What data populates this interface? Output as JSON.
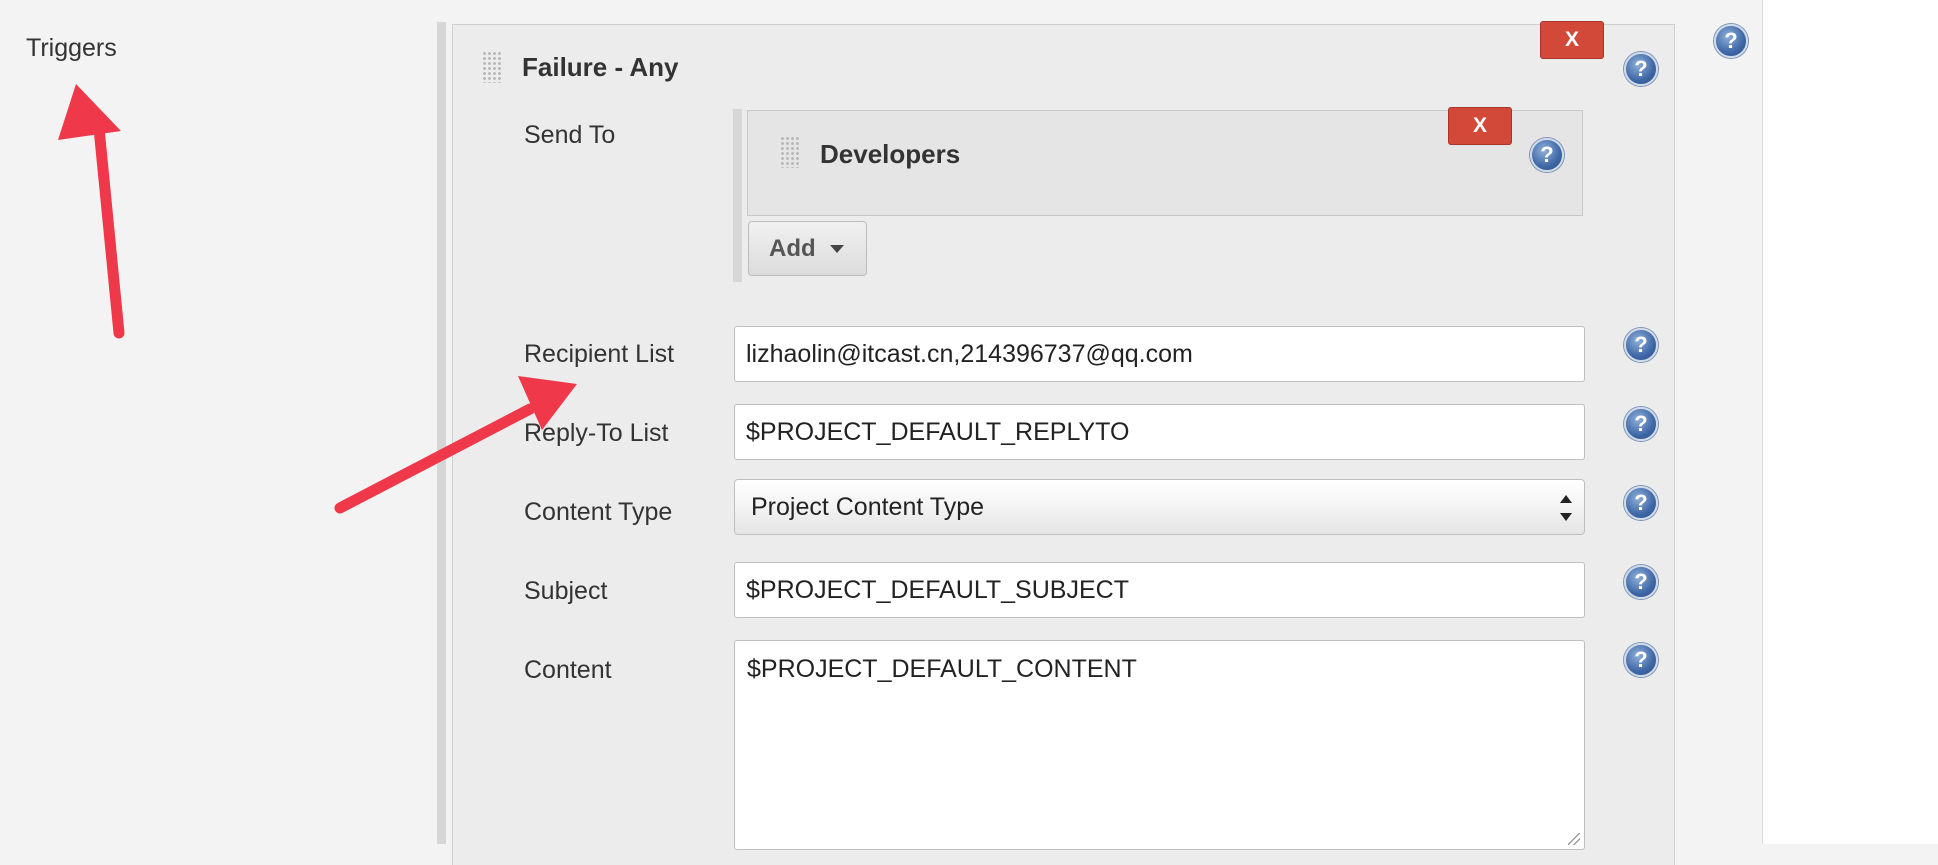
{
  "sidebar": {
    "section_label": "Triggers"
  },
  "trigger": {
    "title": "Failure - Any",
    "delete_label": "X",
    "send_to": {
      "label": "Send To",
      "recipient_type": "Developers",
      "delete_label": "X",
      "add_label": "Add"
    },
    "fields": {
      "recipient_list": {
        "label": "Recipient List",
        "value": "lizhaolin@itcast.cn,214396737@qq.com"
      },
      "reply_to_list": {
        "label": "Reply-To List",
        "value": "$PROJECT_DEFAULT_REPLYTO"
      },
      "content_type": {
        "label": "Content Type",
        "selected": "Project Content Type"
      },
      "subject": {
        "label": "Subject",
        "value": "$PROJECT_DEFAULT_SUBJECT"
      },
      "content": {
        "label": "Content",
        "value": "$PROJECT_DEFAULT_CONTENT"
      }
    }
  },
  "help_icon": {
    "label": "?",
    "icon": "help-icon"
  },
  "annotation": {
    "arrow_color": "#f0384b"
  },
  "colors": {
    "delete_button": "#d24939",
    "help_icon": "#3e67a6"
  }
}
